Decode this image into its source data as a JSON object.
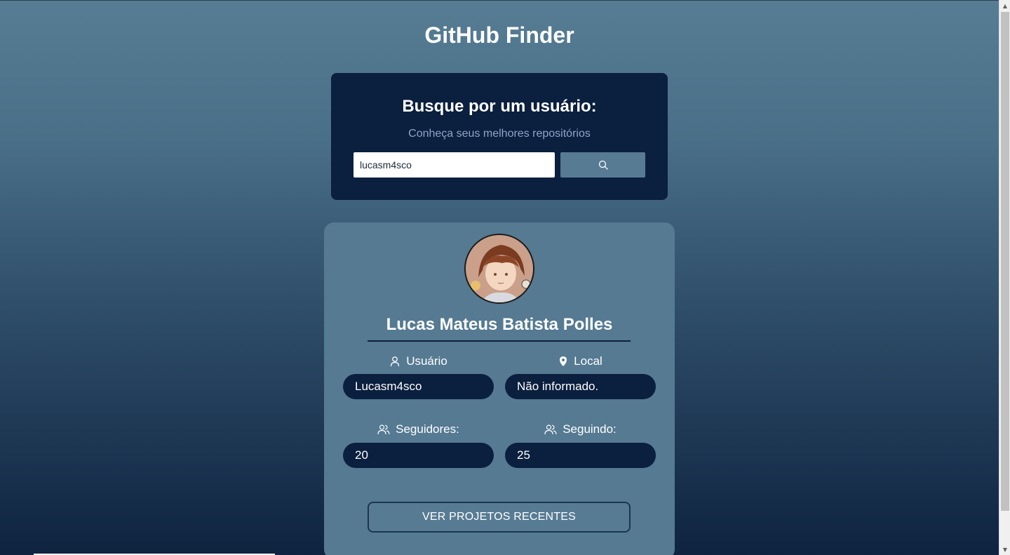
{
  "app": {
    "title": "GitHub Finder"
  },
  "search": {
    "heading": "Busque por um usuário:",
    "subheading": "Conheça seus melhores repositórios",
    "input_value": "lucasm4sco",
    "button_icon": "search-icon"
  },
  "profile": {
    "name": "Lucas Mateus Batista Polles",
    "user": {
      "label": "Usuário",
      "icon": "user-icon",
      "value": "Lucasm4sco"
    },
    "location": {
      "label": "Local",
      "icon": "map-pin-icon",
      "value": "Não informado."
    },
    "followers": {
      "label": "Seguidores:",
      "icon": "users-icon",
      "value": "20"
    },
    "following": {
      "label": "Seguindo:",
      "icon": "users-icon",
      "value": "25"
    },
    "projects_button": "VER PROJETOS RECENTES"
  },
  "colors": {
    "panel_dark": "#0b1f3e",
    "card": "#557a92",
    "accent_text": "#8ea6c8"
  }
}
